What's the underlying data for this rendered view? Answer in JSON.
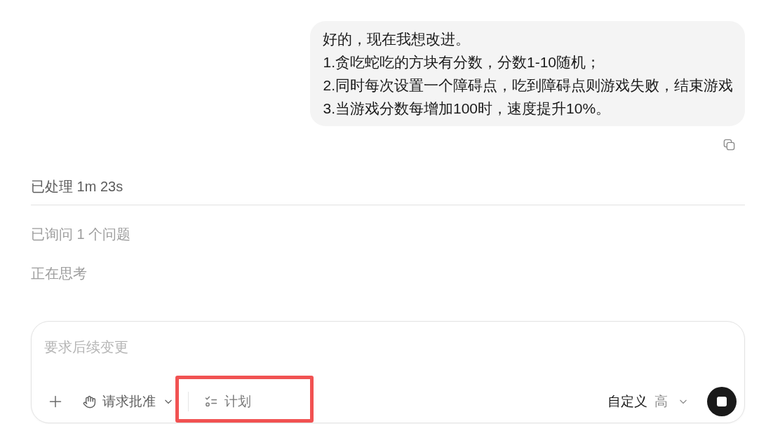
{
  "message": {
    "lines": [
      "好的，现在我想改进。",
      "1.贪吃蛇吃的方块有分数，分数1-10随机；",
      "2.同时每次设置一个障碍点，吃到障碍点则游戏失败，结束游戏",
      "3.当游戏分数每增加100时，速度提升10%。"
    ]
  },
  "activity": {
    "duration_label": "已处理 1m 23s",
    "steps": [
      "已询问 1 个问题",
      "正在思考"
    ]
  },
  "composer": {
    "placeholder": "要求后续变更",
    "approval": {
      "label": "请求批准"
    },
    "plan": {
      "label": "计划",
      "highlighted": true
    },
    "model": {
      "label": "自定义",
      "effort": "高"
    }
  }
}
